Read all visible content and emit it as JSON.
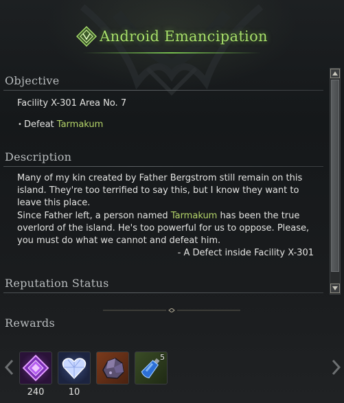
{
  "title": "Android Emancipation",
  "objective": {
    "heading": "Objective",
    "location": "Facility X-301 Area No. 7",
    "task_prefix": "Defeat ",
    "task_target": "Tarmakum"
  },
  "description": {
    "heading": "Description",
    "lines": [
      "Many of my kin created by Father Bergstrom still remain on this",
      "island. They're too terrified to say this, but I know they want to",
      "leave this place."
    ],
    "line4": "Since Father left, a person named ",
    "line4_name": "Tarmakum",
    "line4_suffix": " has been the true",
    "lines_after": [
      "overlord of the island. He's too powerful for us to oppose. Please,",
      "you must do what we cannot and defeat him."
    ],
    "signature": "- A Defect inside Facility X-301"
  },
  "reputation": {
    "heading": "Reputation Status"
  },
  "rewards": {
    "heading": "Rewards",
    "items": [
      {
        "icon": "purple-crystal-icon",
        "count": "240"
      },
      {
        "icon": "heart-gem-icon",
        "count": "10"
      },
      {
        "icon": "ore-chunk-icon",
        "count": ""
      },
      {
        "icon": "blue-potion-icon",
        "badge": "5"
      }
    ]
  },
  "colors": {
    "title": "#a9e06d",
    "highlight": "#b6d66a",
    "text": "#e4e4e2"
  }
}
